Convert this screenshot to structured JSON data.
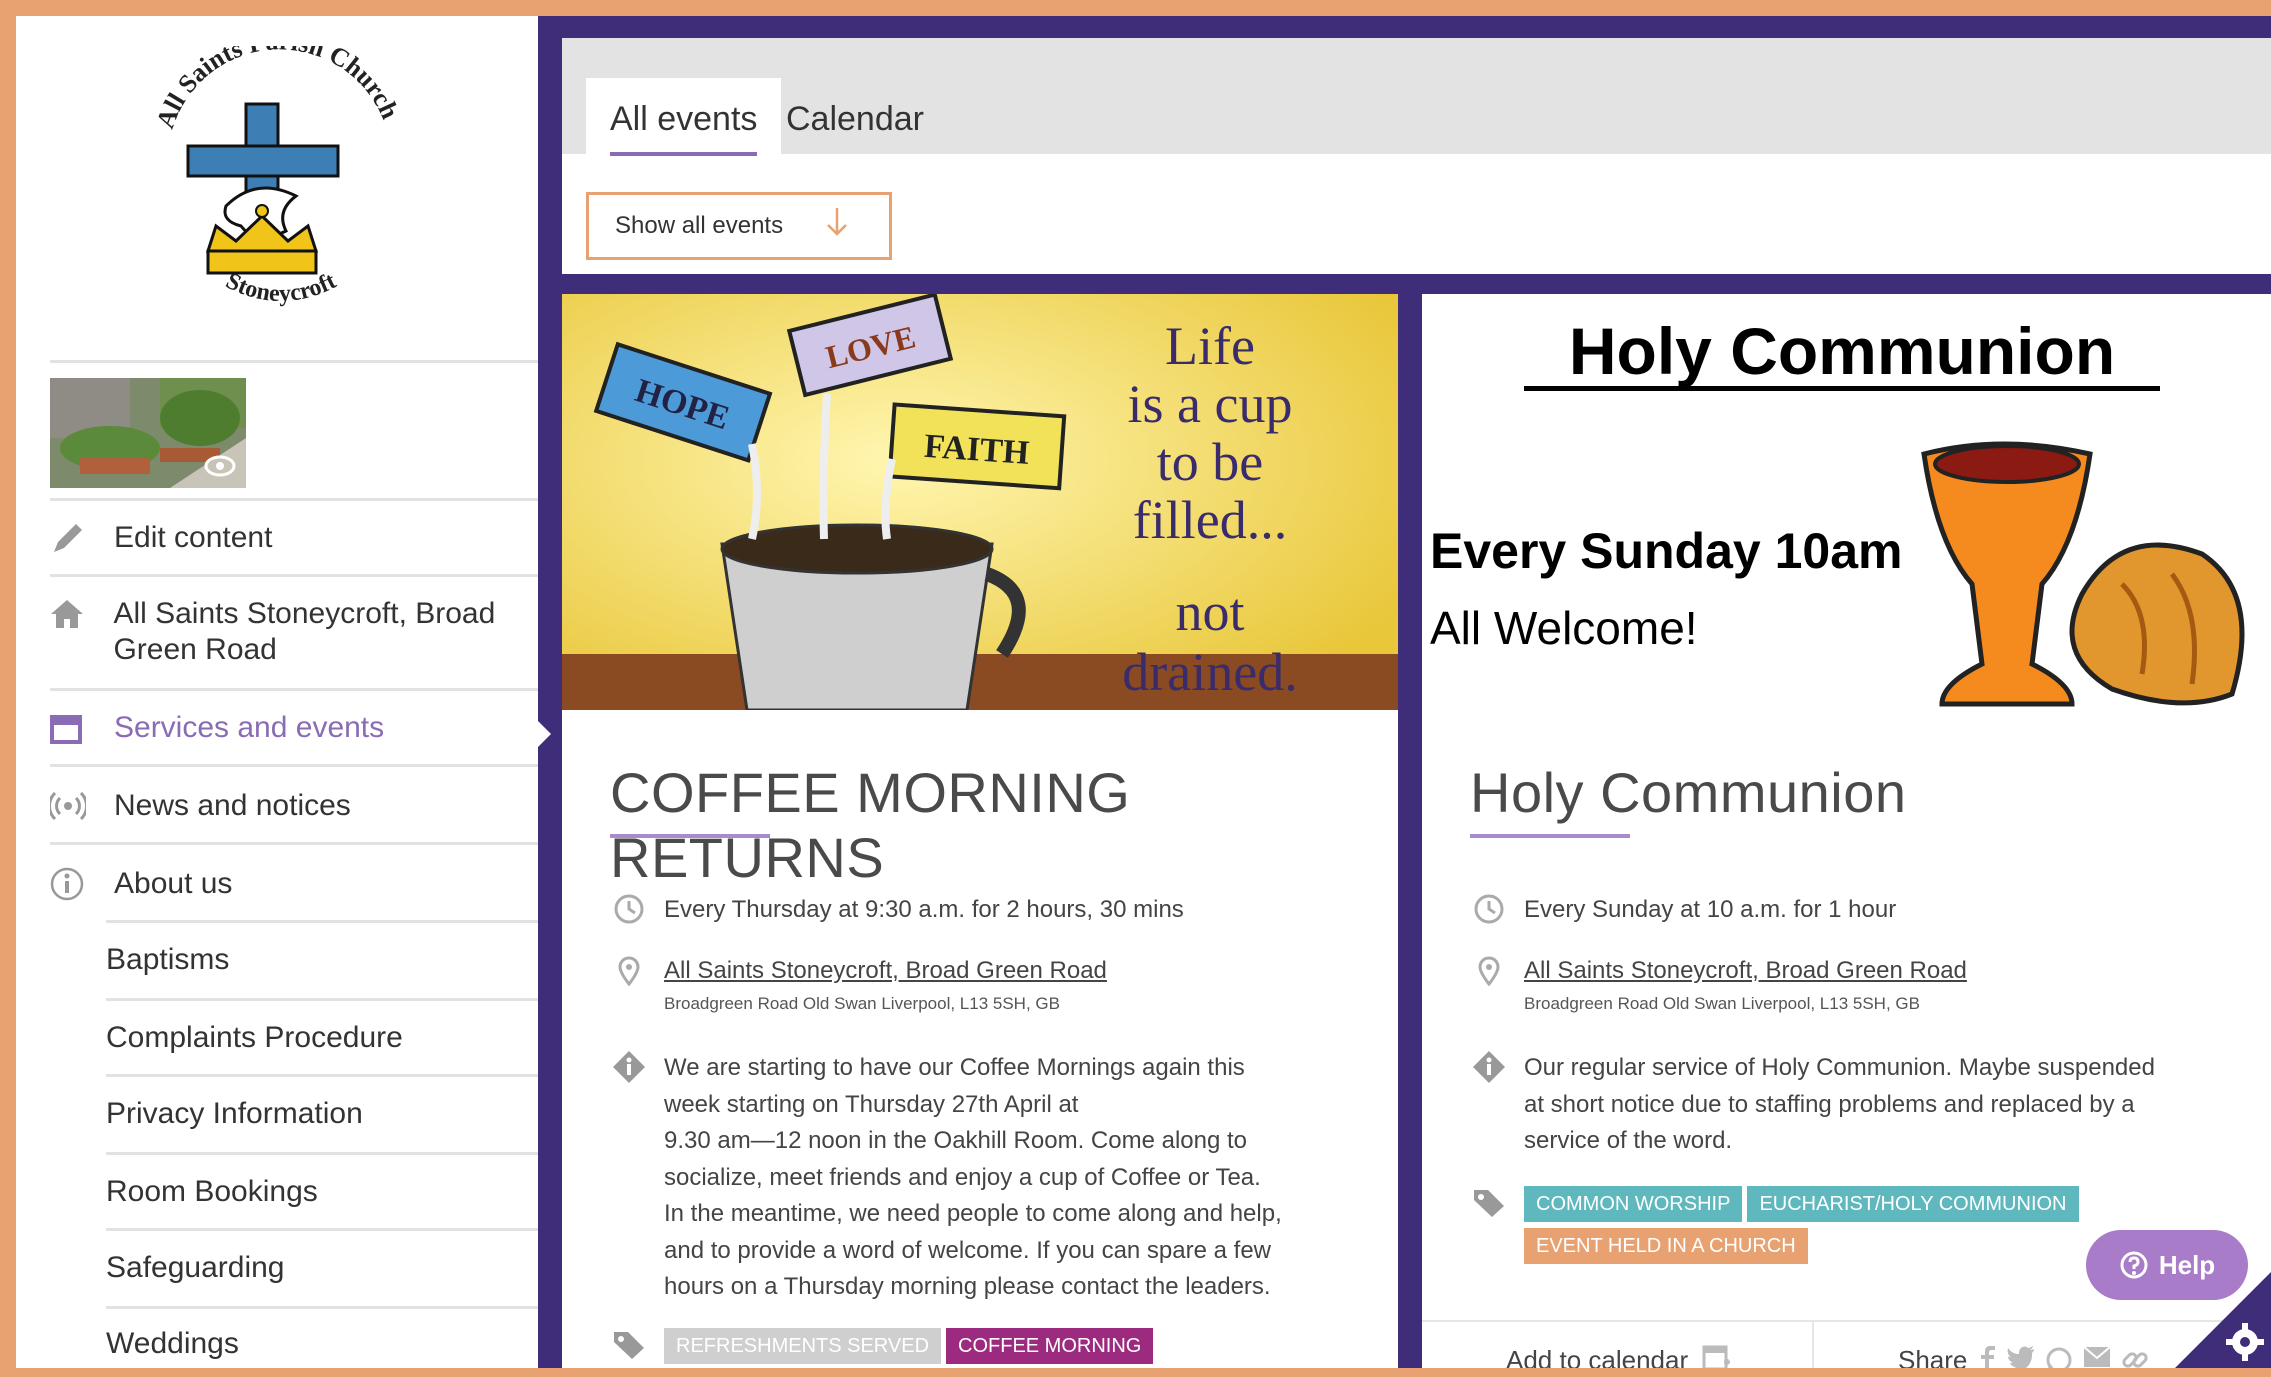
{
  "logo": {
    "arc_top": "All Saints Parish Church",
    "arc_bottom": "Stoneycroft"
  },
  "sidebar": {
    "items": [
      {
        "label": "Edit content",
        "icon": "pencil-icon"
      },
      {
        "label": "All Saints Stoneycroft, Broad Green Road",
        "icon": "home-icon"
      },
      {
        "label": "Services and events",
        "icon": "calendar-icon",
        "active": true
      },
      {
        "label": "News and notices",
        "icon": "broadcast-icon"
      },
      {
        "label": "About us",
        "icon": "info-icon"
      }
    ],
    "subitems": [
      "Baptisms",
      "Complaints Procedure",
      "Privacy Information",
      "Room Bookings",
      "Safeguarding",
      "Weddings"
    ]
  },
  "tabs": [
    {
      "label": "All events",
      "active": true
    },
    {
      "label": "Calendar",
      "active": false
    }
  ],
  "filter": {
    "label": "Show all events"
  },
  "events": [
    {
      "image_text": {
        "mug_hope": "HOPE",
        "mug_love": "LOVE",
        "mug_faith": "FAITH",
        "line1": "Life",
        "line2": "is a cup",
        "line3": "to be",
        "line4": "filled...",
        "line5": "not",
        "line6": "drained."
      },
      "title": "COFFEE MORNING RETURNS",
      "schedule": "Every Thursday at 9:30 a.m. for 2 hours, 30 mins",
      "venue": "All Saints Stoneycroft, Broad Green Road",
      "address": "Broadgreen Road Old Swan Liverpool, L13 5SH, GB",
      "description": [
        "We are starting to have our Coffee Mornings again this",
        "week starting on Thursday 27th April at",
        "9.30 am—12 noon in the Oakhill Room. Come along to",
        "socialize, meet friends and enjoy a cup of Coffee or Tea.",
        "In the meantime, we need people to come along and help,",
        "and to provide a word of welcome. If you can spare a few",
        "hours on a Thursday morning please contact the leaders."
      ],
      "tags": [
        {
          "label": "REFRESHMENTS SERVED",
          "color": "#cfcfcf"
        },
        {
          "label": "COFFEE MORNING",
          "color": "#9c2a7f"
        }
      ]
    },
    {
      "image_text": {
        "heading": "Holy Communion",
        "line1": "Every Sunday 10am",
        "line2": "All Welcome!"
      },
      "title": "Holy Communion",
      "schedule": "Every Sunday at 10 a.m. for 1 hour",
      "venue": "All Saints Stoneycroft, Broad Green Road",
      "address": "Broadgreen Road Old Swan Liverpool, L13 5SH, GB",
      "description": [
        "Our regular service of Holy Communion. Maybe suspended",
        "at short notice due to staffing problems and replaced by a",
        "service of the word."
      ],
      "tags": [
        {
          "label": "COMMON WORSHIP",
          "color": "#5fb8bd"
        },
        {
          "label": "EUCHARIST/HOLY COMMUNION",
          "color": "#5fb8bd"
        },
        {
          "label": "EVENT HELD IN A CHURCH",
          "color": "#e8a171"
        }
      ],
      "footer": {
        "add_calendar": "Add to calendar",
        "share": "Share"
      }
    }
  ],
  "help": {
    "label": "Help"
  },
  "colors": {
    "accent": "#8a6bb5",
    "frame": "#e8a171",
    "main_bg": "#3f2d7a"
  }
}
